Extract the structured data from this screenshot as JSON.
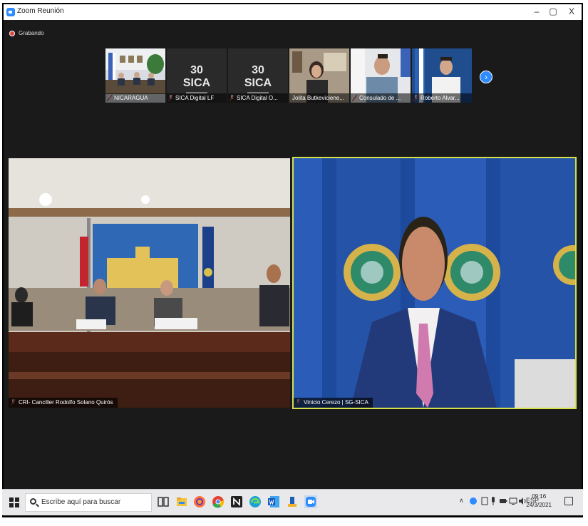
{
  "window": {
    "title": "Zoom Reunión",
    "minimize": "–",
    "maximize": "▢",
    "close": "X"
  },
  "recording": {
    "label": "Grabando"
  },
  "thumbnails": [
    {
      "label": "NICARAGUA"
    },
    {
      "label": "SICA Digital LF",
      "logo": "30 SICA"
    },
    {
      "label": "SICA Digital O...",
      "logo": "30 SICA"
    },
    {
      "label": "Jolita Butkeviciene..."
    },
    {
      "label": "Consulado de ..."
    },
    {
      "label": "Roberto Alvar..."
    }
  ],
  "next_page": {
    "icon": "chevron-right-icon",
    "glyph": "›"
  },
  "videos": {
    "left": {
      "label": "CRI- Canciller Rodolfo Solano Quirós"
    },
    "right": {
      "label": "Vinicio Cerezo | SG-SICA"
    }
  },
  "taskbar": {
    "search_placeholder": "Escribe aquí para buscar",
    "language": "ESP",
    "time": "09:16",
    "date": "24/3/2021"
  },
  "colors": {
    "zoom_blue": "#2d8cff",
    "active_speaker_border": "#d6e04a",
    "recording_red": "#e0443e"
  }
}
